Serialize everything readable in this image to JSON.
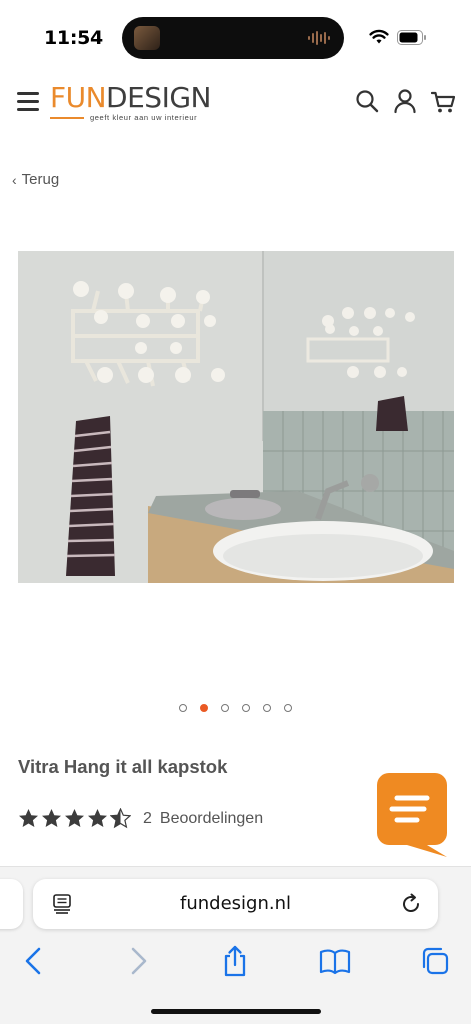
{
  "status_bar": {
    "time": "11:54"
  },
  "header": {
    "logo_fun": "FUN",
    "logo_design": "DESIGN",
    "logo_tagline": "geeft kleur aan uw interieur",
    "icons": [
      "menu-icon",
      "search-icon",
      "account-icon",
      "cart-icon"
    ]
  },
  "navigation": {
    "back_chevron": "‹",
    "back_label": "Terug"
  },
  "product": {
    "title": "Vitra Hang it all kapstok",
    "rating": 4.5,
    "max_rating": 5,
    "review_count": "2",
    "review_label": "Beoordelingen"
  },
  "carousel": {
    "total_slides": 6,
    "active_index": 1
  },
  "browser": {
    "url": "fundesign.nl"
  },
  "colors": {
    "brand_orange": "#ea8a2c",
    "active_dot": "#ea5a24",
    "ios_blue": "#1a73e8"
  }
}
